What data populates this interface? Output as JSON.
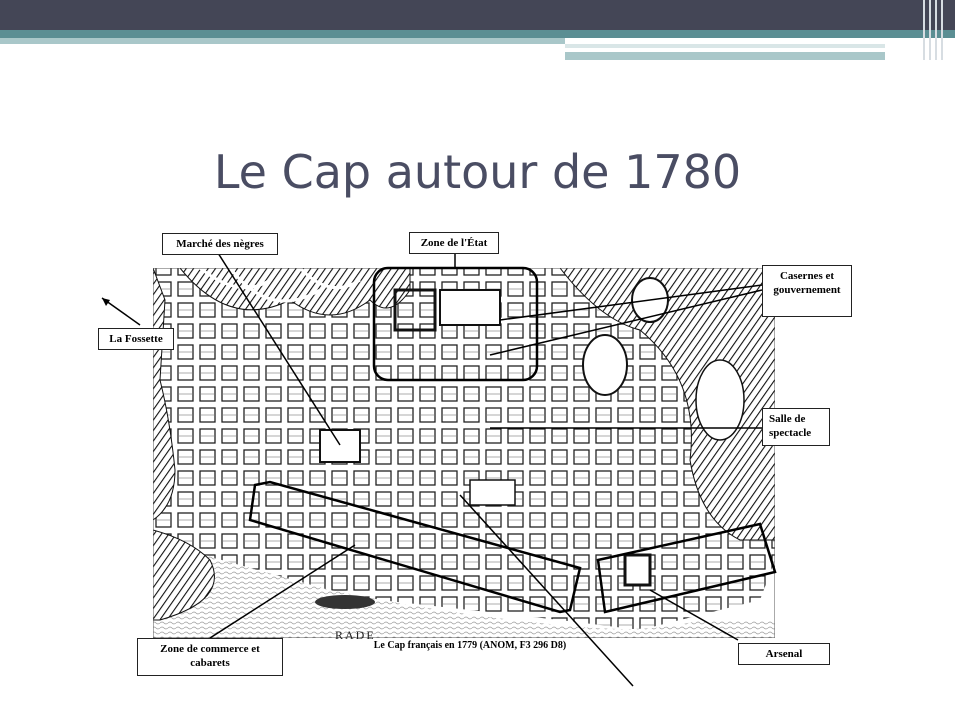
{
  "slide": {
    "title": "Le Cap autour de 1780"
  },
  "labels": {
    "marche": "Marché des nègres",
    "etat": "Zone de l'État",
    "casernes": "Casernes et gouvernement",
    "fossette": "La Fossette",
    "salle": "Salle de spectacle",
    "commerce": "Zone de commerce et cabarets",
    "arsenal": "Arsenal"
  },
  "map": {
    "caption": "Le Cap français en 1779 (ANOM, F3 296 D8)",
    "rade": "RADE"
  }
}
